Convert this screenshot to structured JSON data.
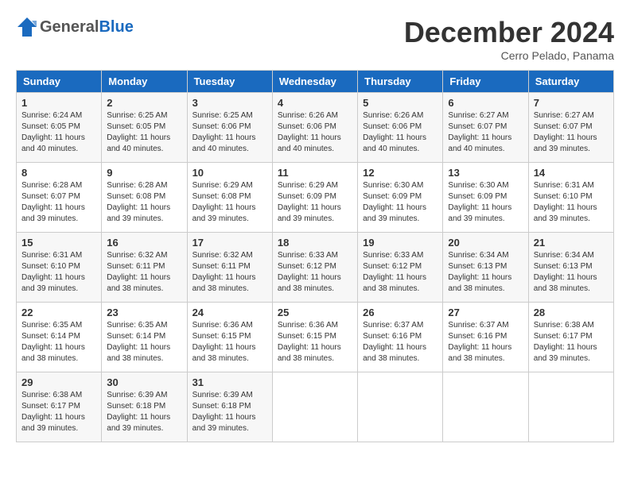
{
  "header": {
    "logo_general": "General",
    "logo_blue": "Blue",
    "month_title": "December 2024",
    "location": "Cerro Pelado, Panama"
  },
  "weekdays": [
    "Sunday",
    "Monday",
    "Tuesday",
    "Wednesday",
    "Thursday",
    "Friday",
    "Saturday"
  ],
  "weeks": [
    [
      {
        "day": "1",
        "sunrise": "Sunrise: 6:24 AM",
        "sunset": "Sunset: 6:05 PM",
        "daylight": "Daylight: 11 hours and 40 minutes."
      },
      {
        "day": "2",
        "sunrise": "Sunrise: 6:25 AM",
        "sunset": "Sunset: 6:05 PM",
        "daylight": "Daylight: 11 hours and 40 minutes."
      },
      {
        "day": "3",
        "sunrise": "Sunrise: 6:25 AM",
        "sunset": "Sunset: 6:06 PM",
        "daylight": "Daylight: 11 hours and 40 minutes."
      },
      {
        "day": "4",
        "sunrise": "Sunrise: 6:26 AM",
        "sunset": "Sunset: 6:06 PM",
        "daylight": "Daylight: 11 hours and 40 minutes."
      },
      {
        "day": "5",
        "sunrise": "Sunrise: 6:26 AM",
        "sunset": "Sunset: 6:06 PM",
        "daylight": "Daylight: 11 hours and 40 minutes."
      },
      {
        "day": "6",
        "sunrise": "Sunrise: 6:27 AM",
        "sunset": "Sunset: 6:07 PM",
        "daylight": "Daylight: 11 hours and 40 minutes."
      },
      {
        "day": "7",
        "sunrise": "Sunrise: 6:27 AM",
        "sunset": "Sunset: 6:07 PM",
        "daylight": "Daylight: 11 hours and 39 minutes."
      }
    ],
    [
      {
        "day": "8",
        "sunrise": "Sunrise: 6:28 AM",
        "sunset": "Sunset: 6:07 PM",
        "daylight": "Daylight: 11 hours and 39 minutes."
      },
      {
        "day": "9",
        "sunrise": "Sunrise: 6:28 AM",
        "sunset": "Sunset: 6:08 PM",
        "daylight": "Daylight: 11 hours and 39 minutes."
      },
      {
        "day": "10",
        "sunrise": "Sunrise: 6:29 AM",
        "sunset": "Sunset: 6:08 PM",
        "daylight": "Daylight: 11 hours and 39 minutes."
      },
      {
        "day": "11",
        "sunrise": "Sunrise: 6:29 AM",
        "sunset": "Sunset: 6:09 PM",
        "daylight": "Daylight: 11 hours and 39 minutes."
      },
      {
        "day": "12",
        "sunrise": "Sunrise: 6:30 AM",
        "sunset": "Sunset: 6:09 PM",
        "daylight": "Daylight: 11 hours and 39 minutes."
      },
      {
        "day": "13",
        "sunrise": "Sunrise: 6:30 AM",
        "sunset": "Sunset: 6:09 PM",
        "daylight": "Daylight: 11 hours and 39 minutes."
      },
      {
        "day": "14",
        "sunrise": "Sunrise: 6:31 AM",
        "sunset": "Sunset: 6:10 PM",
        "daylight": "Daylight: 11 hours and 39 minutes."
      }
    ],
    [
      {
        "day": "15",
        "sunrise": "Sunrise: 6:31 AM",
        "sunset": "Sunset: 6:10 PM",
        "daylight": "Daylight: 11 hours and 39 minutes."
      },
      {
        "day": "16",
        "sunrise": "Sunrise: 6:32 AM",
        "sunset": "Sunset: 6:11 PM",
        "daylight": "Daylight: 11 hours and 38 minutes."
      },
      {
        "day": "17",
        "sunrise": "Sunrise: 6:32 AM",
        "sunset": "Sunset: 6:11 PM",
        "daylight": "Daylight: 11 hours and 38 minutes."
      },
      {
        "day": "18",
        "sunrise": "Sunrise: 6:33 AM",
        "sunset": "Sunset: 6:12 PM",
        "daylight": "Daylight: 11 hours and 38 minutes."
      },
      {
        "day": "19",
        "sunrise": "Sunrise: 6:33 AM",
        "sunset": "Sunset: 6:12 PM",
        "daylight": "Daylight: 11 hours and 38 minutes."
      },
      {
        "day": "20",
        "sunrise": "Sunrise: 6:34 AM",
        "sunset": "Sunset: 6:13 PM",
        "daylight": "Daylight: 11 hours and 38 minutes."
      },
      {
        "day": "21",
        "sunrise": "Sunrise: 6:34 AM",
        "sunset": "Sunset: 6:13 PM",
        "daylight": "Daylight: 11 hours and 38 minutes."
      }
    ],
    [
      {
        "day": "22",
        "sunrise": "Sunrise: 6:35 AM",
        "sunset": "Sunset: 6:14 PM",
        "daylight": "Daylight: 11 hours and 38 minutes."
      },
      {
        "day": "23",
        "sunrise": "Sunrise: 6:35 AM",
        "sunset": "Sunset: 6:14 PM",
        "daylight": "Daylight: 11 hours and 38 minutes."
      },
      {
        "day": "24",
        "sunrise": "Sunrise: 6:36 AM",
        "sunset": "Sunset: 6:15 PM",
        "daylight": "Daylight: 11 hours and 38 minutes."
      },
      {
        "day": "25",
        "sunrise": "Sunrise: 6:36 AM",
        "sunset": "Sunset: 6:15 PM",
        "daylight": "Daylight: 11 hours and 38 minutes."
      },
      {
        "day": "26",
        "sunrise": "Sunrise: 6:37 AM",
        "sunset": "Sunset: 6:16 PM",
        "daylight": "Daylight: 11 hours and 38 minutes."
      },
      {
        "day": "27",
        "sunrise": "Sunrise: 6:37 AM",
        "sunset": "Sunset: 6:16 PM",
        "daylight": "Daylight: 11 hours and 38 minutes."
      },
      {
        "day": "28",
        "sunrise": "Sunrise: 6:38 AM",
        "sunset": "Sunset: 6:17 PM",
        "daylight": "Daylight: 11 hours and 39 minutes."
      }
    ],
    [
      {
        "day": "29",
        "sunrise": "Sunrise: 6:38 AM",
        "sunset": "Sunset: 6:17 PM",
        "daylight": "Daylight: 11 hours and 39 minutes."
      },
      {
        "day": "30",
        "sunrise": "Sunrise: 6:39 AM",
        "sunset": "Sunset: 6:18 PM",
        "daylight": "Daylight: 11 hours and 39 minutes."
      },
      {
        "day": "31",
        "sunrise": "Sunrise: 6:39 AM",
        "sunset": "Sunset: 6:18 PM",
        "daylight": "Daylight: 11 hours and 39 minutes."
      },
      null,
      null,
      null,
      null
    ]
  ]
}
